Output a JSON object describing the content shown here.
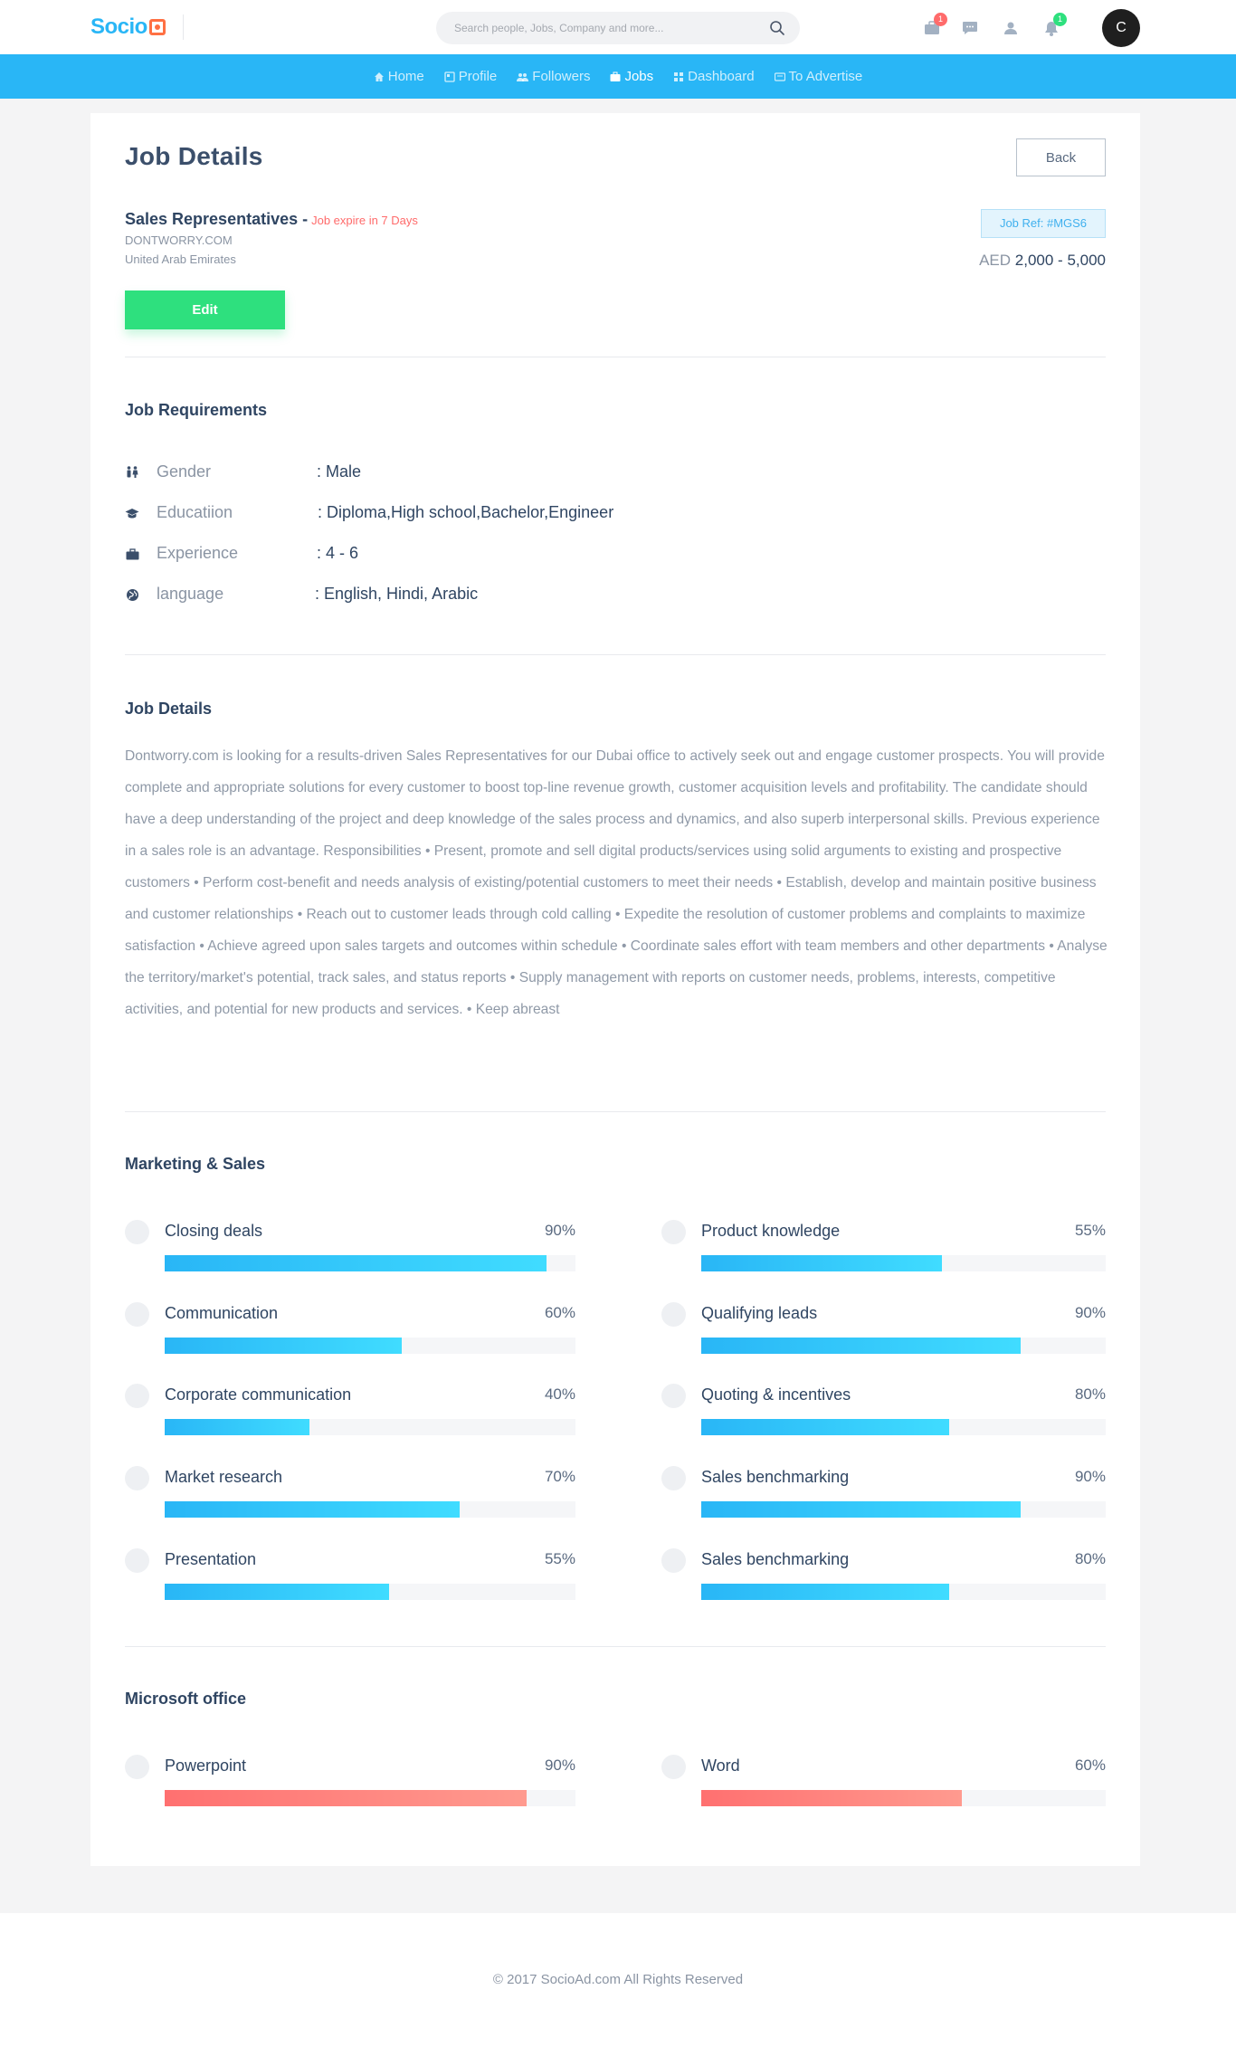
{
  "header": {
    "logo": "Socio",
    "search_placeholder": "Search people, Jobs, Company and more...",
    "badges": {
      "jobs": "1",
      "notifications": "1"
    },
    "avatar_letter": "C"
  },
  "nav": {
    "items": [
      {
        "label": "Home",
        "icon": "home-icon"
      },
      {
        "label": "Profile",
        "icon": "profile-icon"
      },
      {
        "label": "Followers",
        "icon": "followers-icon"
      },
      {
        "label": "Jobs",
        "icon": "briefcase-icon",
        "active": true
      },
      {
        "label": "Dashboard",
        "icon": "dashboard-icon"
      },
      {
        "label": "To Advertise",
        "icon": "advertise-icon"
      }
    ]
  },
  "page": {
    "title": "Job Details",
    "back_label": "Back",
    "job_title": "Sales Representatives -",
    "expire": "Job expire in 7 Days",
    "company": "DONTWORRY.COM",
    "location": "United Arab Emirates",
    "job_ref": "Job Ref: #MGS6",
    "salary_currency": "AED",
    "salary_range": "2,000 - 5,000",
    "edit_label": "Edit"
  },
  "requirements": {
    "title": "Job Requirements",
    "rows": [
      {
        "label": "Gender",
        "value": ": Male",
        "icon": "gender-icon"
      },
      {
        "label": "Educatiion",
        "value": ": Diploma,High school,Bachelor,Engineer",
        "icon": "graduation-cap-icon"
      },
      {
        "label": "Experience",
        "value": ": 4 - 6",
        "icon": "briefcase-icon"
      },
      {
        "label": "language",
        "value": ": English, Hindi, Arabic",
        "icon": "globe-icon"
      }
    ]
  },
  "details": {
    "title": "Job Details",
    "text": "Dontworry.com is looking for a results-driven Sales Representatives for our Dubai office to actively seek out and engage customer prospects. You will provide complete and appropriate solutions for every customer to boost top-line revenue growth, customer acquisition levels and profitability. The candidate should have a deep understanding of the project and deep knowledge of the sales process and dynamics, and also superb interpersonal skills. Previous experience in a sales role is an advantage. Responsibilities • Present, promote and sell digital products/services using solid arguments to existing and prospective customers • Perform cost-benefit and needs analysis of existing/potential customers to meet their needs • Establish, develop and maintain positive business and customer relationships • Reach out to customer leads through cold calling • Expedite the resolution of customer problems and complaints to maximize satisfaction •  Achieve agreed upon sales targets and outcomes within schedule • Coordinate sales effort with team members and other departments •  Analyse the territory/market's potential, track sales, and status reports • Supply management with reports on customer needs, problems, interests, competitive activities, and potential for new products and services. • Keep abreast"
  },
  "marketing": {
    "title": "Marketing & Sales",
    "left": [
      {
        "name": "Closing deals",
        "pct_label": "90%",
        "value": 0.93
      },
      {
        "name": "Communication",
        "pct_label": "60%",
        "value": 0.577
      },
      {
        "name": "Corporate communication",
        "pct_label": "40%",
        "value": 0.353
      },
      {
        "name": "Market research",
        "pct_label": "70%",
        "value": 0.717
      },
      {
        "name": "Presentation",
        "pct_label": "55%",
        "value": 0.547
      }
    ],
    "right": [
      {
        "name": "Product knowledge",
        "pct_label": "55%",
        "value": 0.595
      },
      {
        "name": "Qualifying leads",
        "pct_label": "90%",
        "value": 0.79
      },
      {
        "name": "Quoting & incentives",
        "pct_label": "80%",
        "value": 0.612
      },
      {
        "name": "Sales benchmarking",
        "pct_label": "90%",
        "value": 0.79
      },
      {
        "name": "Sales benchmarking",
        "pct_label": "80%",
        "value": 0.612
      }
    ]
  },
  "office": {
    "title": "Microsoft office",
    "left": [
      {
        "name": "Powerpoint",
        "pct_label": "90%",
        "value": 0.88
      }
    ],
    "right": [
      {
        "name": "Word",
        "pct_label": "60%",
        "value": 0.645
      }
    ]
  },
  "footer": {
    "copyright": "© 2017 SocioAd.com All Rights Reserved"
  },
  "colors": {
    "primary": "#29b6f6",
    "edit": "#2ee07e",
    "expire": "#ff6b6b",
    "office_bar": "#ff7070"
  }
}
